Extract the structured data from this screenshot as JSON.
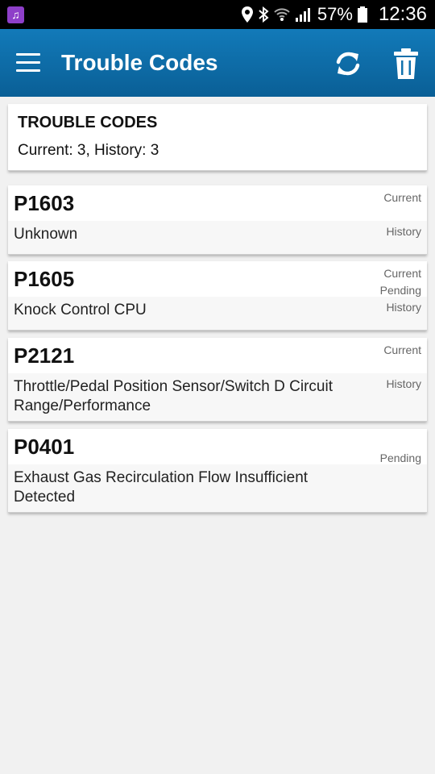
{
  "status_bar": {
    "battery": "57%",
    "time": "12:36",
    "icons": [
      "music-icon",
      "location-icon",
      "bluetooth-icon",
      "wifi-icon",
      "signal-icon",
      "battery-icon"
    ]
  },
  "app_bar": {
    "title": "Trouble Codes",
    "color": "#0f6fab",
    "icons": [
      "menu-icon",
      "refresh-icon",
      "trash-icon"
    ]
  },
  "summary": {
    "title": "TROUBLE CODES",
    "counts": "Current: 3, History: 3"
  },
  "codes": [
    {
      "code": "P1603",
      "description": "Unknown",
      "statuses": [
        "Current",
        "History"
      ]
    },
    {
      "code": "P1605",
      "description": "Knock Control CPU",
      "statuses": [
        "Current",
        "Pending",
        "History"
      ]
    },
    {
      "code": "P2121",
      "description": "Throttle/Pedal Position Sensor/Switch D Circuit Range/Performance",
      "statuses": [
        "Current",
        "History"
      ]
    },
    {
      "code": "P0401",
      "description": "Exhaust Gas Recirculation Flow Insufficient Detected",
      "statuses": [
        "Pending"
      ]
    }
  ]
}
